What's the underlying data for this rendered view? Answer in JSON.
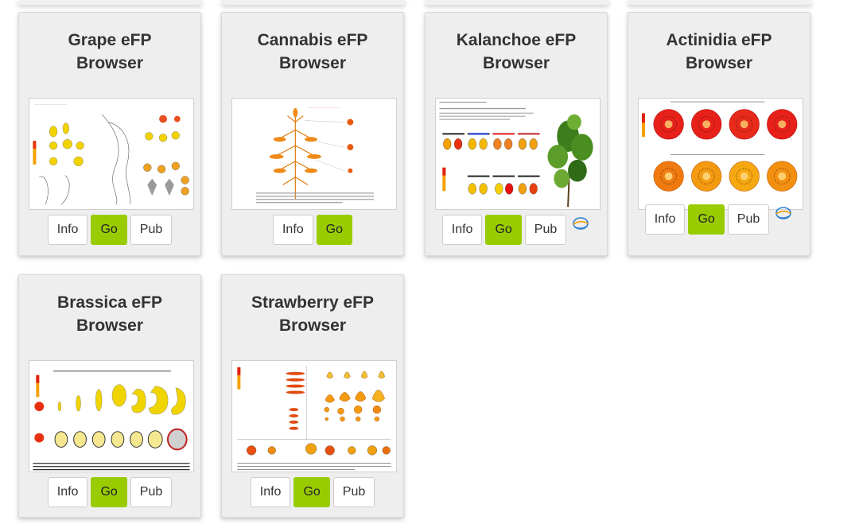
{
  "buttons": {
    "info": "Info",
    "go": "Go",
    "pub": "Pub"
  },
  "colors": {
    "accent": "#99cc00",
    "card_bg": "#eeeeee",
    "efp_yellow": "#ffe000",
    "efp_orange": "#f08010",
    "efp_red": "#e02010"
  },
  "cards": [
    {
      "title": "Grape eFP Browser",
      "thumbnail": "grape-efp-thumbnail",
      "has_pub": true,
      "has_pub_icon": false
    },
    {
      "title": "Cannabis eFP Browser",
      "thumbnail": "cannabis-efp-thumbnail",
      "has_pub": false,
      "has_pub_icon": false
    },
    {
      "title": "Kalanchoe eFP Browser",
      "thumbnail": "kalanchoe-efp-thumbnail",
      "has_pub": true,
      "has_pub_icon": true
    },
    {
      "title": "Actinidia eFP Browser",
      "thumbnail": "actinidia-efp-thumbnail",
      "has_pub": true,
      "has_pub_icon": true
    },
    {
      "title": "Brassica eFP Browser",
      "thumbnail": "brassica-efp-thumbnail",
      "has_pub": true,
      "has_pub_icon": false
    },
    {
      "title": "Strawberry eFP Browser",
      "thumbnail": "strawberry-efp-thumbnail",
      "has_pub": true,
      "has_pub_icon": false
    }
  ]
}
